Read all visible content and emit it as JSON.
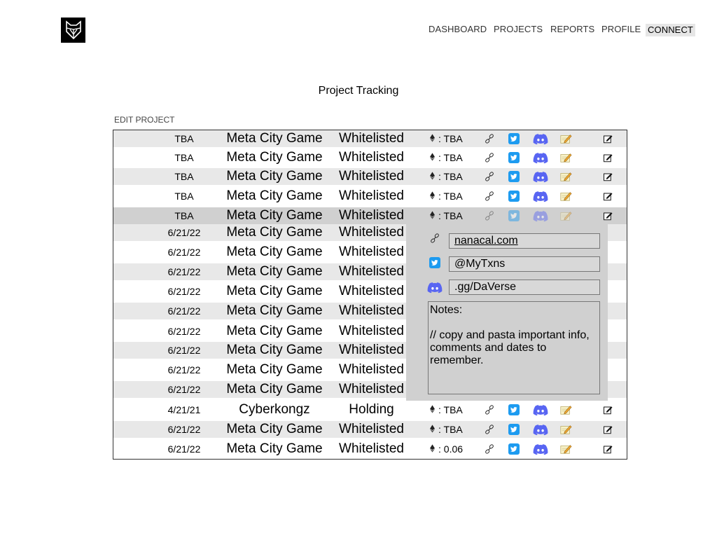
{
  "nav": {
    "items": [
      "DASHBOARD",
      "PROJECTS",
      "REPORTS",
      "PROFILE"
    ],
    "connect_label": "CONNECT"
  },
  "page_title": "Project Tracking",
  "edit_label": "EDIT PROJECT",
  "rows": [
    {
      "date": "TBA",
      "name": "Meta City Game",
      "status": "Whitelisted",
      "price": ": TBA"
    },
    {
      "date": "TBA",
      "name": "Meta City Game",
      "status": "Whitelisted",
      "price": ": TBA"
    },
    {
      "date": "TBA",
      "name": "Meta City Game",
      "status": "Whitelisted",
      "price": ": TBA"
    },
    {
      "date": "TBA",
      "name": "Meta City Game",
      "status": "Whitelisted",
      "price": ": TBA"
    },
    {
      "date": "TBA",
      "name": "Meta City Game",
      "status": "Whitelisted",
      "price": ": TBA"
    },
    {
      "date": "6/21/22",
      "name": "Meta City Game",
      "status": "Whitelisted",
      "price": ""
    },
    {
      "date": "6/21/22",
      "name": "Meta City Game",
      "status": "Whitelisted",
      "price": ""
    },
    {
      "date": "6/21/22",
      "name": "Meta City Game",
      "status": "Whitelisted",
      "price": ""
    },
    {
      "date": "6/21/22",
      "name": "Meta City Game",
      "status": "Whitelisted",
      "price": ""
    },
    {
      "date": "6/21/22",
      "name": "Meta City Game",
      "status": "Whitelisted",
      "price": ""
    },
    {
      "date": "6/21/22",
      "name": "Meta City Game",
      "status": "Whitelisted",
      "price": ""
    },
    {
      "date": "6/21/22",
      "name": "Meta City Game",
      "status": "Whitelisted",
      "price": ""
    },
    {
      "date": "6/21/22",
      "name": "Meta City Game",
      "status": "Whitelisted",
      "price": ""
    },
    {
      "date": "6/21/22",
      "name": "Meta City Game",
      "status": "Whitelisted",
      "price": ""
    },
    {
      "date": "4/21/21",
      "name": "Cyberkongz",
      "status": "Holding",
      "price": ": TBA"
    },
    {
      "date": "6/21/22",
      "name": "Meta City Game",
      "status": "Whitelisted",
      "price": ": TBA"
    },
    {
      "date": "6/21/22",
      "name": "Meta City Game",
      "status": "Whitelisted",
      "price": ": 0.06"
    }
  ],
  "detail_panel": {
    "website": "nanacal.com",
    "twitter": "@MyTxns",
    "discord": ".gg/DaVerse",
    "notes_title": "Notes:",
    "notes_body": "// copy and pasta important info, comments and dates to remember."
  },
  "colors": {
    "twitter_blue": "#1d9bf0",
    "discord_blurple": "#5865f2",
    "row_grey": "#e8e8e8",
    "selected_grey": "#d0d0d0"
  },
  "icons": {
    "currency": "ethereum-icon",
    "link": "link-icon",
    "twitter": "twitter-icon",
    "discord": "discord-icon",
    "notes": "notepad-icon",
    "edit": "edit-icon"
  }
}
